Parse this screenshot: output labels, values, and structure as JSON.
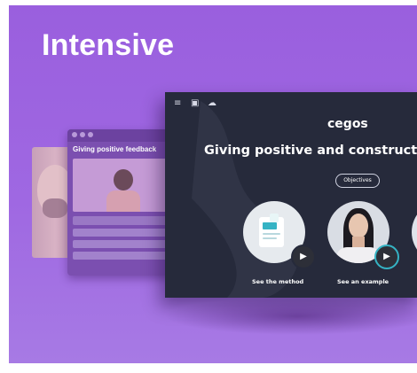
{
  "card": {
    "title": "Intensive"
  },
  "feedback_window": {
    "title": "Giving positive feedback"
  },
  "course_window": {
    "toolbar_icons": [
      "menu-icon",
      "screen-icon",
      "cloud-icon"
    ],
    "brand": "cegos",
    "heading": "Giving positive and constructive",
    "objectives_button": "Objectives",
    "cards": [
      {
        "caption": "See the method",
        "icon": "document-icon"
      },
      {
        "caption": "See an example",
        "icon": "person-photo"
      }
    ]
  },
  "colors": {
    "background_purple": "#9f68e2",
    "window_dark": "#262a3b",
    "accent_teal": "#35b3c4"
  }
}
